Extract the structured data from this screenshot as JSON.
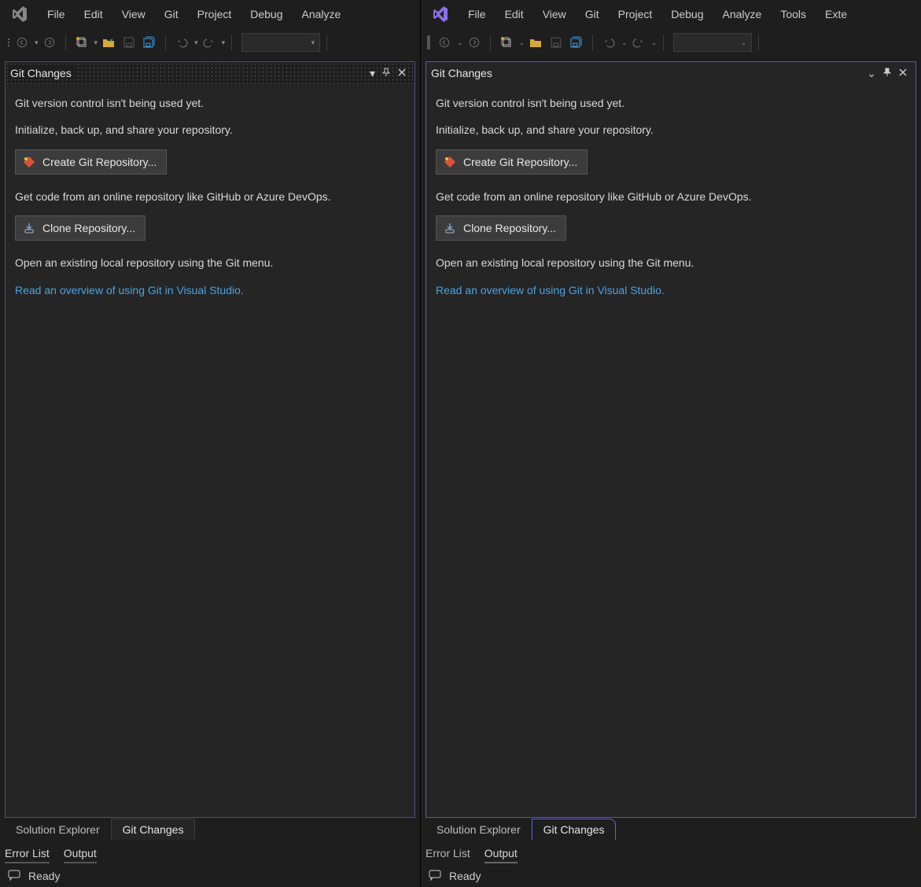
{
  "menus_left": [
    "File",
    "Edit",
    "View",
    "Git",
    "Project",
    "Debug",
    "Analyze"
  ],
  "menus_right": [
    "File",
    "Edit",
    "View",
    "Git",
    "Project",
    "Debug",
    "Analyze",
    "Tools",
    "Exte"
  ],
  "panel": {
    "title": "Git Changes",
    "line1": "Git version control isn't being used yet.",
    "line2": "Initialize, back up, and share your repository.",
    "btn_create": "Create Git Repository...",
    "line3": "Get code from an online repository like GitHub or Azure DevOps.",
    "btn_clone": "Clone Repository...",
    "line4": "Open an existing local repository using the Git menu.",
    "link": "Read an overview of using Git in Visual Studio."
  },
  "tabs": {
    "solution": "Solution Explorer",
    "git": "Git Changes"
  },
  "bottom_tabs": {
    "errors": "Error List",
    "output": "Output"
  },
  "status": "Ready"
}
